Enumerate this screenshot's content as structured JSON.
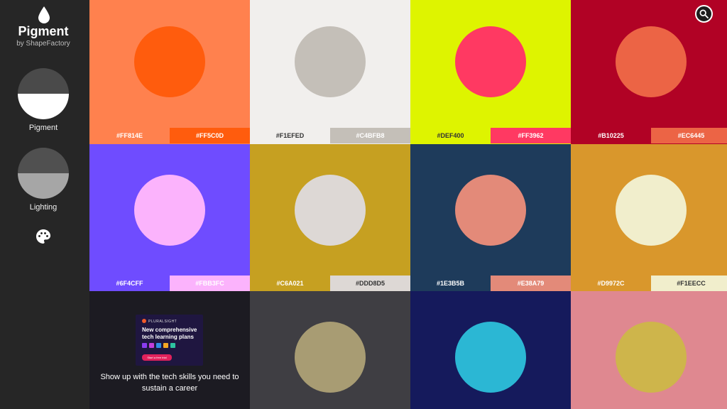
{
  "sidebar": {
    "app_title": "Pigment",
    "app_subtitle": "by ShapeFactory",
    "modes": [
      {
        "label": "Pigment",
        "top_color": "#4a4a4a",
        "bottom_color": "#ffffff"
      },
      {
        "label": "Lighting",
        "top_color": "#505050",
        "bottom_color": "#a6a6a6"
      }
    ]
  },
  "ad": {
    "brand": "PLURALSIGHT",
    "headline": "New comprehensive tech learning plans",
    "cta": "Start a free trial",
    "caption": "Show up with the tech skills you need to sustain a career"
  },
  "tiles": [
    {
      "bg": "#FF814E",
      "circle": "#FF5C0D",
      "swatches": [
        {
          "code": "#FF814E",
          "bg": "#FF814E",
          "fg": "#ffffff"
        },
        {
          "code": "#FF5C0D",
          "bg": "#FF5C0D",
          "fg": "#ffffff"
        }
      ]
    },
    {
      "bg": "#F1EFED",
      "circle": "#C4BFB8",
      "swatches": [
        {
          "code": "#F1EFED",
          "bg": "#F1EFED",
          "fg": "#333333"
        },
        {
          "code": "#C4BFB8",
          "bg": "#C4BFB8",
          "fg": "#ffffff"
        }
      ]
    },
    {
      "bg": "#DEF400",
      "circle": "#FF3962",
      "swatches": [
        {
          "code": "#DEF400",
          "bg": "#DEF400",
          "fg": "#333333"
        },
        {
          "code": "#FF3962",
          "bg": "#FF3962",
          "fg": "#ffffff"
        }
      ]
    },
    {
      "bg": "#B10225",
      "circle": "#EC6445",
      "swatches": [
        {
          "code": "#B10225",
          "bg": "#B10225",
          "fg": "#ffffff"
        },
        {
          "code": "#EC6445",
          "bg": "#EC6445",
          "fg": "#ffffff"
        }
      ]
    },
    {
      "bg": "#6F4CFF",
      "circle": "#FBB3FC",
      "swatches": [
        {
          "code": "#6F4CFF",
          "bg": "#6F4CFF",
          "fg": "#ffffff"
        },
        {
          "code": "#FBB3FC",
          "bg": "#FBB3FC",
          "fg": "#ffffff"
        }
      ]
    },
    {
      "bg": "#C6A021",
      "circle": "#DDD8D5",
      "swatches": [
        {
          "code": "#C6A021",
          "bg": "#C6A021",
          "fg": "#ffffff"
        },
        {
          "code": "#DDD8D5",
          "bg": "#DDD8D5",
          "fg": "#333333"
        }
      ]
    },
    {
      "bg": "#1E3B5B",
      "circle": "#E38A79",
      "swatches": [
        {
          "code": "#1E3B5B",
          "bg": "#1E3B5B",
          "fg": "#ffffff"
        },
        {
          "code": "#E38A79",
          "bg": "#E38A79",
          "fg": "#ffffff"
        }
      ]
    },
    {
      "bg": "#D9972C",
      "circle": "#F1EECC",
      "swatches": [
        {
          "code": "#D9972C",
          "bg": "#D9972C",
          "fg": "#ffffff"
        },
        {
          "code": "#F1EECC",
          "bg": "#F1EECC",
          "fg": "#333333"
        }
      ]
    },
    {
      "bg": "#3F3E43",
      "circle": "#A89C73",
      "swatches": []
    },
    {
      "bg": "#151A5C",
      "circle": "#2BB7D4",
      "swatches": []
    },
    {
      "bg": "#DF8890",
      "circle": "#CEB54B",
      "swatches": []
    }
  ]
}
